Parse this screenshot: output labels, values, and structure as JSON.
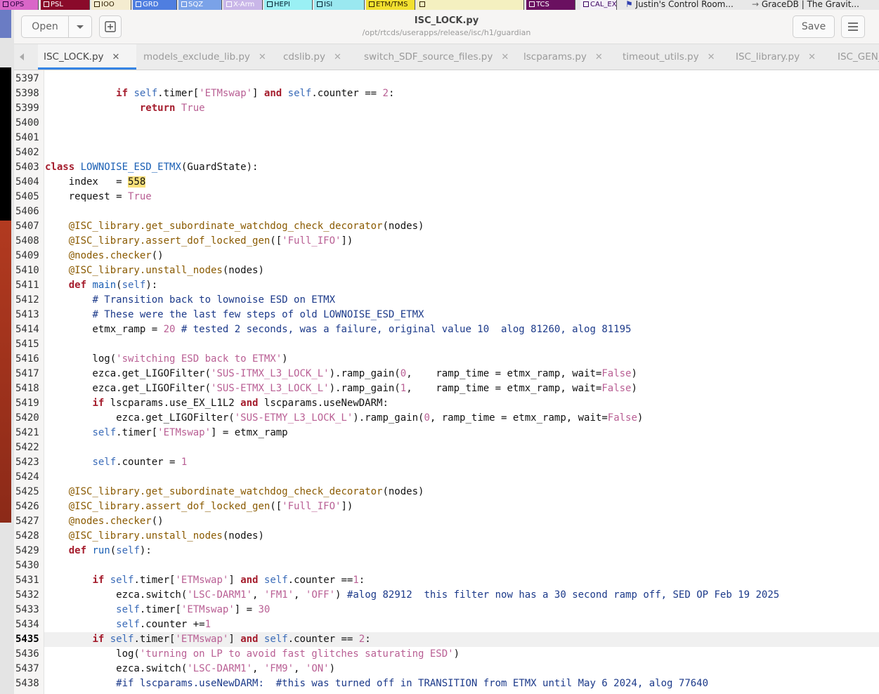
{
  "taskbar": {
    "items": [
      {
        "label": "OPS",
        "bg": "#d966c8",
        "fg": "#2a0040"
      },
      {
        "label": "PSL",
        "bg": "#8a0a2a",
        "fg": "#ffffff"
      },
      {
        "label": "IOO",
        "bg": "#f4ecd0",
        "fg": "#302000"
      },
      {
        "label": "GRD",
        "bg": "#4f7ee0",
        "fg": "#ffffff"
      },
      {
        "label": "SQZ",
        "bg": "#7aa2e8",
        "fg": "#ffffff"
      },
      {
        "label": "X-Arm",
        "bg": "#c9b6e8",
        "fg": "#ffffff"
      },
      {
        "label": "HEPI",
        "bg": "#9af0f4",
        "fg": "#002030"
      },
      {
        "label": "ISI",
        "bg": "#9ae8f0",
        "fg": "#002030"
      },
      {
        "label": "ETM/TMS",
        "bg": "#f2e030",
        "fg": "#302000"
      },
      {
        "label": "",
        "bg": "#f4f0c0",
        "fg": "#302000"
      },
      {
        "label": "TCS",
        "bg": "#6a1060",
        "fg": "#ffffff"
      },
      {
        "label": "CAL_EX",
        "bg": "#f4f0f8",
        "fg": "#3a0060"
      }
    ],
    "browser_tabs": [
      "Justin's Control Room...",
      "GraceDB | The Gravit..."
    ]
  },
  "header": {
    "open_label": "Open",
    "save_label": "Save",
    "title": "ISC_LOCK.py",
    "subtitle": "/opt/rtcds/userapps/release/isc/h1/guardian"
  },
  "tabs": [
    {
      "label": "ISC_LOCK.py",
      "active": true
    },
    {
      "label": "models_exclude_lib.py"
    },
    {
      "label": "cdslib.py"
    },
    {
      "label": "switch_SDF_source_files.py"
    },
    {
      "label": "lscparams.py"
    },
    {
      "label": "timeout_utils.py"
    },
    {
      "label": "ISC_library.py"
    },
    {
      "label": "ISC_GEN_S"
    }
  ],
  "editor": {
    "current_line": 5435,
    "lines": [
      {
        "n": 5397,
        "code": []
      },
      {
        "n": 5398,
        "code": [
          [
            "",
            "            "
          ],
          [
            "kw",
            "if"
          ],
          [
            "",
            " "
          ],
          [
            "slf",
            "self"
          ],
          [
            "",
            ".timer["
          ],
          [
            "str",
            "'ETMswap'"
          ],
          [
            "",
            "] "
          ],
          [
            "kw",
            "and"
          ],
          [
            "",
            " "
          ],
          [
            "slf",
            "self"
          ],
          [
            "",
            ".counter == "
          ],
          [
            "num",
            "2"
          ],
          [
            "",
            ":"
          ]
        ]
      },
      {
        "n": 5399,
        "code": [
          [
            "",
            "                "
          ],
          [
            "kw",
            "return"
          ],
          [
            "",
            " "
          ],
          [
            "bool",
            "True"
          ]
        ]
      },
      {
        "n": 5400,
        "code": []
      },
      {
        "n": 5401,
        "code": []
      },
      {
        "n": 5402,
        "code": []
      },
      {
        "n": 5403,
        "code": [
          [
            "kw",
            "class"
          ],
          [
            "",
            " "
          ],
          [
            "cls",
            "LOWNOISE_ESD_ETMX"
          ],
          [
            "",
            "(GuardState):"
          ]
        ]
      },
      {
        "n": 5404,
        "code": [
          [
            "",
            "    index   = "
          ],
          [
            "hl",
            "558"
          ]
        ]
      },
      {
        "n": 5405,
        "code": [
          [
            "",
            "    request = "
          ],
          [
            "bool",
            "True"
          ]
        ]
      },
      {
        "n": 5406,
        "code": []
      },
      {
        "n": 5407,
        "code": [
          [
            "",
            "    "
          ],
          [
            "dec",
            "@ISC_library.get_subordinate_watchdog_check_decorator"
          ],
          [
            "",
            "(nodes)"
          ]
        ]
      },
      {
        "n": 5408,
        "code": [
          [
            "",
            "    "
          ],
          [
            "dec",
            "@ISC_library.assert_dof_locked_gen"
          ],
          [
            "",
            "(["
          ],
          [
            "str",
            "'Full_IFO'"
          ],
          [
            "",
            "])"
          ]
        ]
      },
      {
        "n": 5409,
        "code": [
          [
            "",
            "    "
          ],
          [
            "dec",
            "@nodes.checker"
          ],
          [
            "",
            "()"
          ]
        ]
      },
      {
        "n": 5410,
        "code": [
          [
            "",
            "    "
          ],
          [
            "dec",
            "@ISC_library.unstall_nodes"
          ],
          [
            "",
            "(nodes)"
          ]
        ]
      },
      {
        "n": 5411,
        "code": [
          [
            "",
            "    "
          ],
          [
            "kw",
            "def"
          ],
          [
            "",
            " "
          ],
          [
            "fn",
            "main"
          ],
          [
            "",
            "("
          ],
          [
            "slf",
            "self"
          ],
          [
            "",
            "):"
          ]
        ]
      },
      {
        "n": 5412,
        "code": [
          [
            "",
            "        "
          ],
          [
            "com",
            "# Transition back to lownoise ESD on ETMX"
          ]
        ]
      },
      {
        "n": 5413,
        "code": [
          [
            "",
            "        "
          ],
          [
            "com",
            "# These were the last few steps of old LOWNOISE_ESD_ETMX"
          ]
        ]
      },
      {
        "n": 5414,
        "code": [
          [
            "",
            "        etmx_ramp = "
          ],
          [
            "num",
            "20"
          ],
          [
            "",
            " "
          ],
          [
            "com",
            "# tested 2 seconds, was a failure, original value 10  alog 81260, alog 81195"
          ]
        ]
      },
      {
        "n": 5415,
        "code": []
      },
      {
        "n": 5416,
        "code": [
          [
            "",
            "        log("
          ],
          [
            "str",
            "'switching ESD back to ETMX'"
          ],
          [
            "",
            ")"
          ]
        ]
      },
      {
        "n": 5417,
        "code": [
          [
            "",
            "        ezca.get_LIGOFilter("
          ],
          [
            "str",
            "'SUS-ITMX_L3_LOCK_L'"
          ],
          [
            "",
            ").ramp_gain("
          ],
          [
            "num",
            "0"
          ],
          [
            "",
            ",    ramp_time = etmx_ramp, wait="
          ],
          [
            "bool",
            "False"
          ],
          [
            "",
            ")"
          ]
        ]
      },
      {
        "n": 5418,
        "code": [
          [
            "",
            "        ezca.get_LIGOFilter("
          ],
          [
            "str",
            "'SUS-ETMX_L3_LOCK_L'"
          ],
          [
            "",
            ").ramp_gain("
          ],
          [
            "num",
            "1"
          ],
          [
            "",
            ",    ramp_time = etmx_ramp, wait="
          ],
          [
            "bool",
            "False"
          ],
          [
            "",
            ")"
          ]
        ]
      },
      {
        "n": 5419,
        "code": [
          [
            "",
            "        "
          ],
          [
            "kw",
            "if"
          ],
          [
            "",
            " lscparams.use_EX_L1L2 "
          ],
          [
            "kw",
            "and"
          ],
          [
            "",
            " lscparams.useNewDARM:"
          ]
        ]
      },
      {
        "n": 5420,
        "code": [
          [
            "",
            "            ezca.get_LIGOFilter("
          ],
          [
            "str",
            "'SUS-ETMY_L3_LOCK_L'"
          ],
          [
            "",
            ").ramp_gain("
          ],
          [
            "num",
            "0"
          ],
          [
            "",
            ", ramp_time = etmx_ramp, wait="
          ],
          [
            "bool",
            "False"
          ],
          [
            "",
            ")"
          ]
        ]
      },
      {
        "n": 5421,
        "code": [
          [
            "",
            "        "
          ],
          [
            "slf",
            "self"
          ],
          [
            "",
            ".timer["
          ],
          [
            "str",
            "'ETMswap'"
          ],
          [
            "",
            "] = etmx_ramp"
          ]
        ]
      },
      {
        "n": 5422,
        "code": []
      },
      {
        "n": 5423,
        "code": [
          [
            "",
            "        "
          ],
          [
            "slf",
            "self"
          ],
          [
            "",
            ".counter = "
          ],
          [
            "num",
            "1"
          ]
        ]
      },
      {
        "n": 5424,
        "code": []
      },
      {
        "n": 5425,
        "code": [
          [
            "",
            "    "
          ],
          [
            "dec",
            "@ISC_library.get_subordinate_watchdog_check_decorator"
          ],
          [
            "",
            "(nodes)"
          ]
        ]
      },
      {
        "n": 5426,
        "code": [
          [
            "",
            "    "
          ],
          [
            "dec",
            "@ISC_library.assert_dof_locked_gen"
          ],
          [
            "",
            "(["
          ],
          [
            "str",
            "'Full_IFO'"
          ],
          [
            "",
            "])"
          ]
        ]
      },
      {
        "n": 5427,
        "code": [
          [
            "",
            "    "
          ],
          [
            "dec",
            "@nodes.checker"
          ],
          [
            "",
            "()"
          ]
        ]
      },
      {
        "n": 5428,
        "code": [
          [
            "",
            "    "
          ],
          [
            "dec",
            "@ISC_library.unstall_nodes"
          ],
          [
            "",
            "(nodes)"
          ]
        ]
      },
      {
        "n": 5429,
        "code": [
          [
            "",
            "    "
          ],
          [
            "kw",
            "def"
          ],
          [
            "",
            " "
          ],
          [
            "fn",
            "run"
          ],
          [
            "",
            "("
          ],
          [
            "slf",
            "self"
          ],
          [
            "",
            "):"
          ]
        ]
      },
      {
        "n": 5430,
        "code": []
      },
      {
        "n": 5431,
        "code": [
          [
            "",
            "        "
          ],
          [
            "kw",
            "if"
          ],
          [
            "",
            " "
          ],
          [
            "slf",
            "self"
          ],
          [
            "",
            ".timer["
          ],
          [
            "str",
            "'ETMswap'"
          ],
          [
            "",
            "] "
          ],
          [
            "kw",
            "and"
          ],
          [
            "",
            " "
          ],
          [
            "slf",
            "self"
          ],
          [
            "",
            ".counter =="
          ],
          [
            "num",
            "1"
          ],
          [
            "",
            ":"
          ]
        ]
      },
      {
        "n": 5432,
        "code": [
          [
            "",
            "            ezca.switch("
          ],
          [
            "str",
            "'LSC-DARM1'"
          ],
          [
            "",
            ", "
          ],
          [
            "str",
            "'FM1'"
          ],
          [
            "",
            ", "
          ],
          [
            "str",
            "'OFF'"
          ],
          [
            "",
            ") "
          ],
          [
            "com",
            "#alog 82912  this filter now has a 30 second ramp off, SED OP Feb 19 2025"
          ]
        ]
      },
      {
        "n": 5433,
        "code": [
          [
            "",
            "            "
          ],
          [
            "slf",
            "self"
          ],
          [
            "",
            ".timer["
          ],
          [
            "str",
            "'ETMswap'"
          ],
          [
            "",
            "] = "
          ],
          [
            "num",
            "30"
          ]
        ]
      },
      {
        "n": 5434,
        "code": [
          [
            "",
            "            "
          ],
          [
            "slf",
            "self"
          ],
          [
            "",
            ".counter +="
          ],
          [
            "num",
            "1"
          ]
        ]
      },
      {
        "n": 5435,
        "code": [
          [
            "",
            "        "
          ],
          [
            "kw",
            "if"
          ],
          [
            "",
            " "
          ],
          [
            "slf",
            "self"
          ],
          [
            "",
            ".timer["
          ],
          [
            "str",
            "'ETMswap'"
          ],
          [
            "",
            "] "
          ],
          [
            "kw",
            "and"
          ],
          [
            "",
            " "
          ],
          [
            "slf",
            "self"
          ],
          [
            "",
            ".counter == "
          ],
          [
            "num",
            "2"
          ],
          [
            "",
            ":"
          ]
        ]
      },
      {
        "n": 5436,
        "code": [
          [
            "",
            "            log("
          ],
          [
            "str",
            "'turning on LP to avoid fast glitches saturating ESD'"
          ],
          [
            "",
            ")"
          ]
        ]
      },
      {
        "n": 5437,
        "code": [
          [
            "",
            "            ezca.switch("
          ],
          [
            "str",
            "'LSC-DARM1'"
          ],
          [
            "",
            ", "
          ],
          [
            "str",
            "'FM9'"
          ],
          [
            "",
            ", "
          ],
          [
            "str",
            "'ON'"
          ],
          [
            "",
            ")"
          ]
        ]
      },
      {
        "n": 5438,
        "code": [
          [
            "",
            "            "
          ],
          [
            "com",
            "#if lscparams.useNewDARM:  #this was turned off in TRANSITION from ETMX until May 6 2024, alog 77640"
          ]
        ]
      }
    ]
  }
}
